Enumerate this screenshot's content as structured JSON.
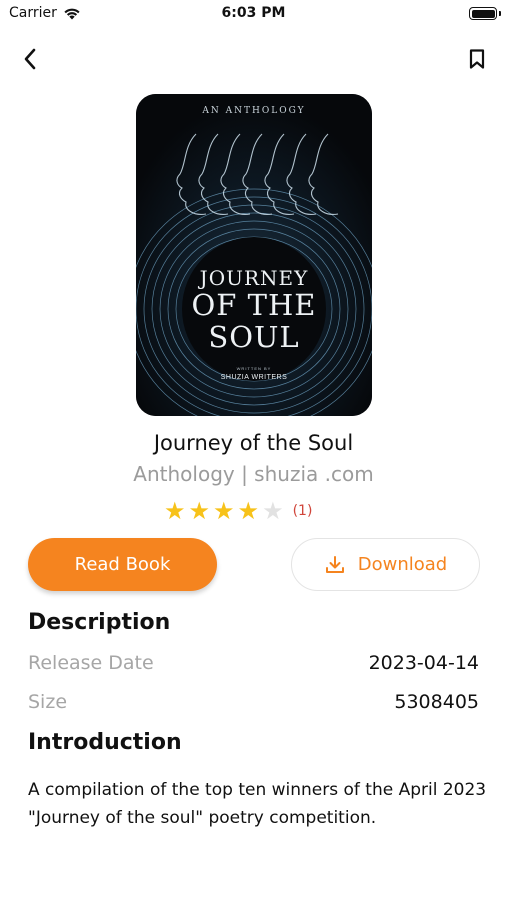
{
  "status_bar": {
    "carrier": "Carrier",
    "time": "6:03 PM"
  },
  "nav": {
    "back_icon": "chevron-left-icon",
    "bookmark_icon": "bookmark-icon"
  },
  "cover": {
    "top_text": "AN ANTHOLOGY",
    "title_line1": "JOURNEY",
    "title_line2": "OF THE",
    "title_line3": "SOUL",
    "written_by": "WRITTEN BY",
    "author": "SHUZIA WRITERS"
  },
  "book": {
    "title": "Journey of the Soul",
    "subtitle": "Anthology | shuzia .com",
    "rating": 4,
    "rating_max": 5,
    "rating_count": "(1)"
  },
  "actions": {
    "read_label": "Read Book",
    "download_label": "Download"
  },
  "description": {
    "heading": "Description",
    "release_label": "Release Date",
    "release_value": "2023-04-14",
    "size_label": "Size",
    "size_value": "5308405"
  },
  "introduction": {
    "heading": "Introduction",
    "text": "A compilation of the top ten winners of the April 2023 \"Journey of the soul\" poetry competition."
  },
  "colors": {
    "accent": "#f5841f",
    "star": "#f7c21a",
    "rating_count": "#d0453a"
  }
}
